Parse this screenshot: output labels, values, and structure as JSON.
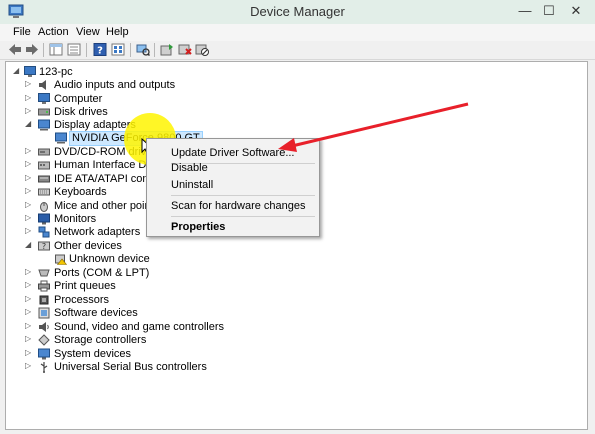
{
  "window": {
    "title": "Device Manager",
    "minimize": "—",
    "maximize": "☐",
    "close": "✕"
  },
  "menu": [
    "File",
    "Action",
    "View",
    "Help"
  ],
  "toolbar": [
    "back-arrow-icon",
    "forward-arrow-icon",
    "|",
    "show-hide-tree-icon",
    "properties-icon",
    "|",
    "help-icon",
    "view-icon",
    "|",
    "scan-hardware-icon",
    "|",
    "update-driver-icon",
    "uninstall-icon",
    "disable-icon"
  ],
  "tree": {
    "root": "123-pc",
    "items": [
      {
        "label": "Audio inputs and outputs",
        "level": 1,
        "icon": "audio-icon"
      },
      {
        "label": "Computer",
        "level": 1,
        "icon": "computer-icon"
      },
      {
        "label": "Disk drives",
        "level": 1,
        "icon": "disk-icon"
      },
      {
        "label": "Display adapters",
        "level": 1,
        "icon": "display-adapter-icon",
        "expanded": true
      },
      {
        "label": "NVIDIA GeForce 9800 GT",
        "level": 2,
        "icon": "display-adapter-icon",
        "selected": true
      },
      {
        "label": "DVD/CD-ROM drives",
        "level": 1,
        "icon": "dvd-icon"
      },
      {
        "label": "Human Interface Device",
        "level": 1,
        "icon": "hid-icon"
      },
      {
        "label": "IDE ATA/ATAPI controlle",
        "level": 1,
        "icon": "ide-icon"
      },
      {
        "label": "Keyboards",
        "level": 1,
        "icon": "keyboard-icon"
      },
      {
        "label": "Mice and other pointing",
        "level": 1,
        "icon": "mouse-icon"
      },
      {
        "label": "Monitors",
        "level": 1,
        "icon": "monitor-icon"
      },
      {
        "label": "Network adapters",
        "level": 1,
        "icon": "network-icon"
      },
      {
        "label": "Other devices",
        "level": 1,
        "icon": "other-devices-icon",
        "expanded": true
      },
      {
        "label": "Unknown device",
        "level": 2,
        "icon": "unknown-device-icon"
      },
      {
        "label": "Ports (COM & LPT)",
        "level": 1,
        "icon": "port-icon"
      },
      {
        "label": "Print queues",
        "level": 1,
        "icon": "printer-icon"
      },
      {
        "label": "Processors",
        "level": 1,
        "icon": "processor-icon"
      },
      {
        "label": "Software devices",
        "level": 1,
        "icon": "software-device-icon"
      },
      {
        "label": "Sound, video and game controllers",
        "level": 1,
        "icon": "sound-icon"
      },
      {
        "label": "Storage controllers",
        "level": 1,
        "icon": "storage-icon"
      },
      {
        "label": "System devices",
        "level": 1,
        "icon": "system-device-icon"
      },
      {
        "label": "Universal Serial Bus controllers",
        "level": 1,
        "icon": "usb-icon"
      }
    ]
  },
  "context_menu": {
    "items": [
      "Update Driver Software...",
      "Disable",
      "Uninstall",
      "Scan for hardware changes",
      "Properties"
    ]
  },
  "colors": {
    "arrow": "#e8202a",
    "highlight": "#fff500",
    "selection": "#cde8ff"
  }
}
